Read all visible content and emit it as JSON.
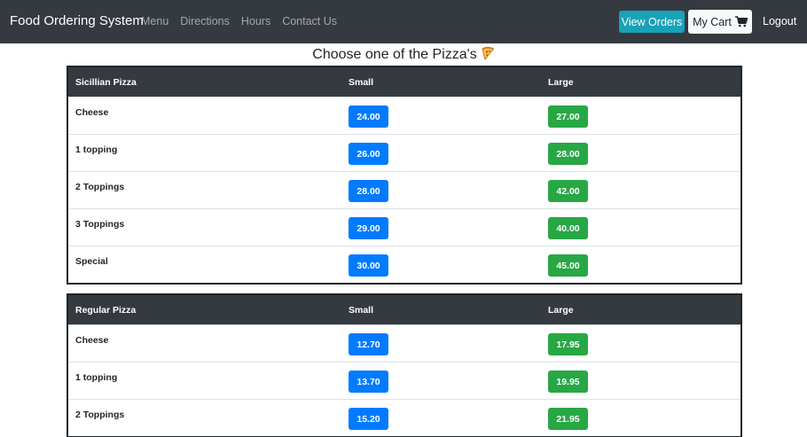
{
  "nav": {
    "brand": "Food Ordering System",
    "links": [
      "Menu",
      "Directions",
      "Hours",
      "Contact Us"
    ],
    "view_orders": "View Orders",
    "my_cart": "My Cart",
    "logout": "Logout"
  },
  "heading": "Choose one of the Pizza's",
  "colors": {
    "navbar": "#343a40",
    "small": "#007bff",
    "large": "#28a745",
    "orders": "#17a2b8"
  },
  "tables": [
    {
      "title": "Sicillian Pizza",
      "col_small": "Small",
      "col_large": "Large",
      "rows": [
        {
          "name": "Cheese",
          "small": "24.00",
          "large": "27.00"
        },
        {
          "name": "1 topping",
          "small": "26.00",
          "large": "28.00"
        },
        {
          "name": "2 Toppings",
          "small": "28.00",
          "large": "42.00"
        },
        {
          "name": "3 Toppings",
          "small": "29.00",
          "large": "40.00"
        },
        {
          "name": "Special",
          "small": "30.00",
          "large": "45.00"
        }
      ]
    },
    {
      "title": "Regular Pizza",
      "col_small": "Small",
      "col_large": "Large",
      "rows": [
        {
          "name": "Cheese",
          "small": "12.70",
          "large": "17.95"
        },
        {
          "name": "1 topping",
          "small": "13.70",
          "large": "19.95"
        },
        {
          "name": "2 Toppings",
          "small": "15.20",
          "large": "21.95"
        }
      ]
    }
  ]
}
